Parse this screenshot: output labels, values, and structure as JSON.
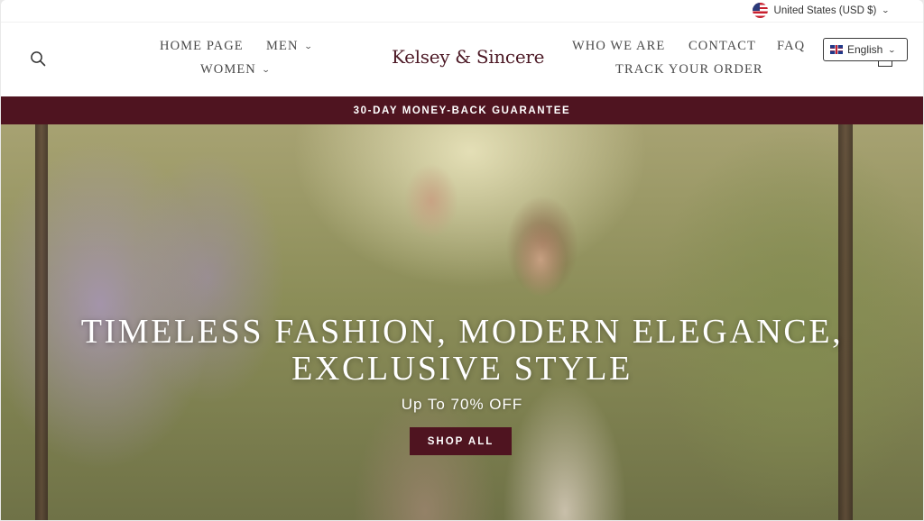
{
  "topbar": {
    "currency_label": "United States (USD $)",
    "flag_icon": "us-flag-icon"
  },
  "header": {
    "logo": "Kelsey & Sincere",
    "nav_left": [
      {
        "label": "HOME PAGE",
        "has_dropdown": false
      },
      {
        "label": "MEN",
        "has_dropdown": true
      },
      {
        "label": "WOMEN",
        "has_dropdown": true
      }
    ],
    "nav_right": [
      {
        "label": "WHO WE ARE"
      },
      {
        "label": "CONTACT"
      },
      {
        "label": "FAQ"
      },
      {
        "label": "TRACK YOUR ORDER"
      }
    ],
    "language": "English",
    "icons": [
      "search-icon",
      "cart-icon",
      "uk-flag-icon",
      "chevron-down-icon"
    ]
  },
  "announcement": {
    "text": "30-DAY MONEY-BACK GUARANTEE"
  },
  "hero": {
    "title_line1": "TIMELESS FASHION, MODERN ELEGANCE,",
    "title_line2": "EXCLUSIVE STYLE",
    "subtitle": "Up To 70% OFF",
    "cta_label": "SHOP ALL"
  },
  "colors": {
    "brand": "#4f1420",
    "logo": "#4d1a26",
    "nav_text": "#4a4a4a"
  }
}
